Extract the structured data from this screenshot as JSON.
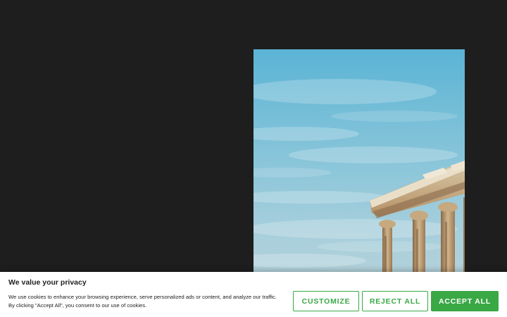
{
  "nav": {
    "items": [
      "",
      "",
      "",
      ""
    ]
  },
  "cookie_banner": {
    "title": "We value your privacy",
    "text_line1": "We use cookies to enhance your browsing experience, serve personalized ads or content, and analyze our traffic.",
    "text_line2": "By clicking \"Accept All\", you consent to our use of cookies.",
    "customize_label": "Customize",
    "reject_label": "Reject All",
    "accept_label": "Accept All"
  },
  "colors": {
    "page_background": "#1e1e1e",
    "accent": "#3aa845",
    "banner_background": "#ffffff",
    "banner_text": "#212121"
  }
}
